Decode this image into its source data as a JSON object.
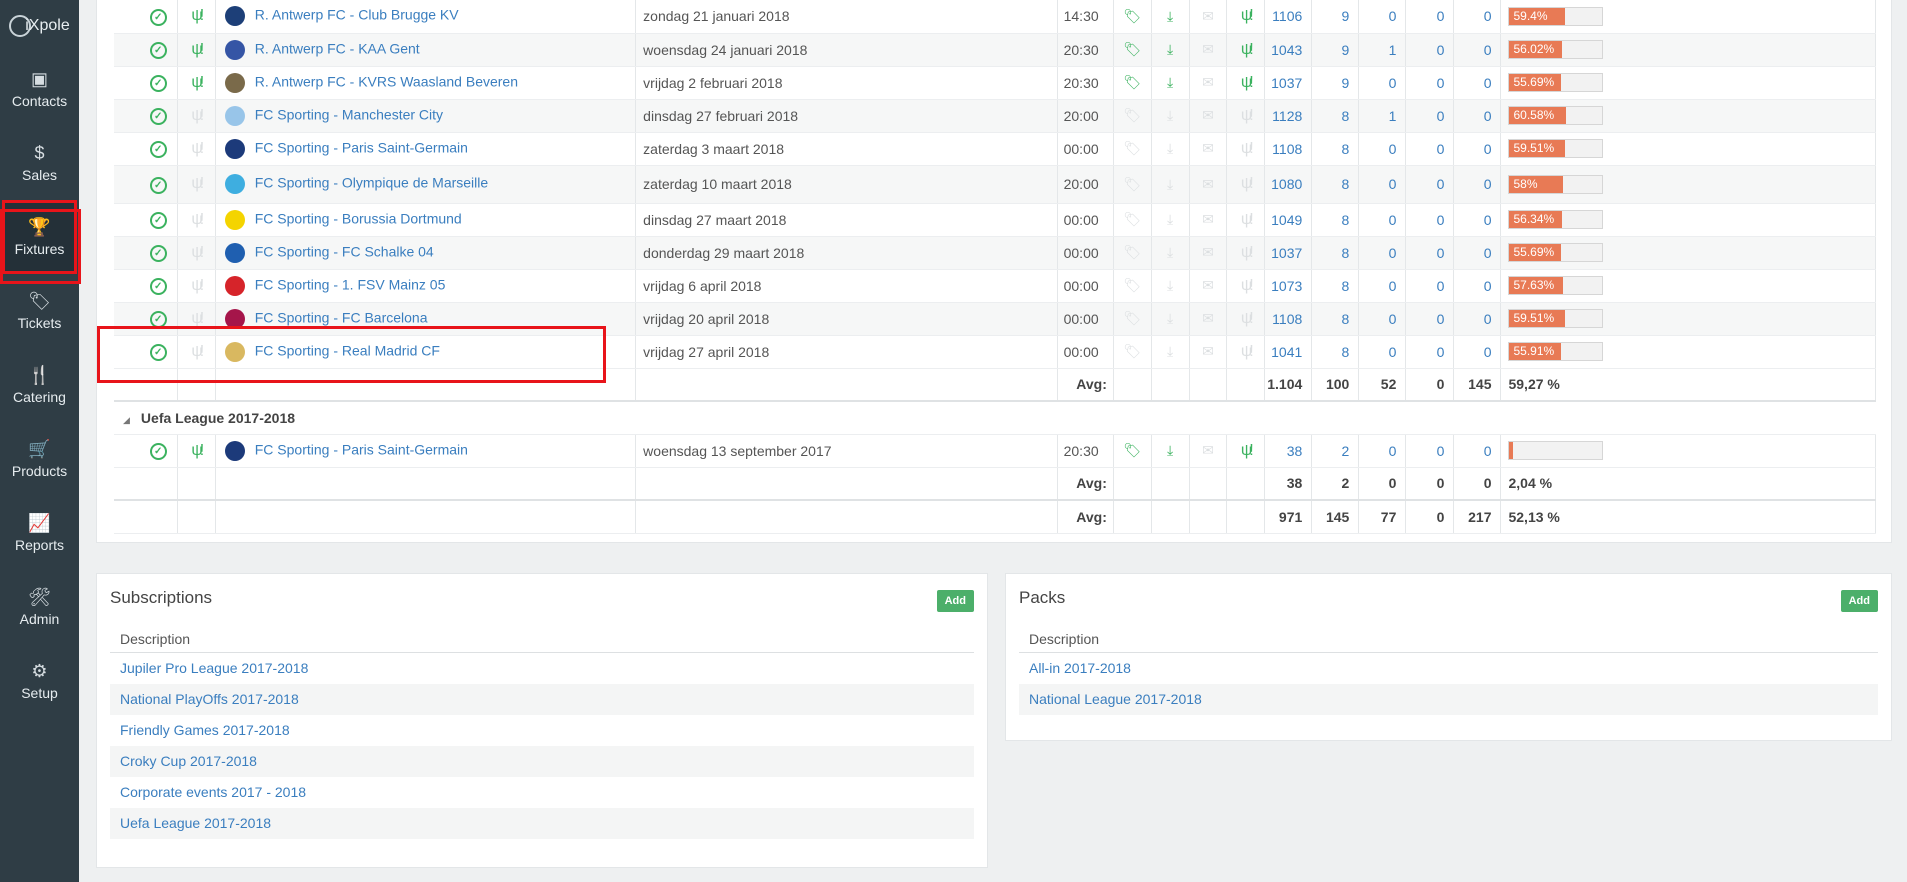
{
  "app": {
    "logo_text": "iXpole"
  },
  "sidebar": {
    "items": [
      {
        "label": "Contacts",
        "icon": "contacts-icon",
        "glyph": "▣"
      },
      {
        "label": "Sales",
        "icon": "coin-icon",
        "glyph": "$"
      },
      {
        "label": "Fixtures",
        "icon": "trophy-icon",
        "glyph": "🏆"
      },
      {
        "label": "Tickets",
        "icon": "ticket-icon",
        "glyph": "🏷"
      },
      {
        "label": "Catering",
        "icon": "fork-knife-icon",
        "glyph": "🍴"
      },
      {
        "label": "Products",
        "icon": "cart-icon",
        "glyph": "🛒"
      },
      {
        "label": "Reports",
        "icon": "chart-icon",
        "glyph": "📈"
      },
      {
        "label": "Admin",
        "icon": "tools-icon",
        "glyph": "🛠"
      },
      {
        "label": "Setup",
        "icon": "gears-icon",
        "glyph": "⚙"
      }
    ]
  },
  "fixtures": {
    "rows": [
      {
        "catering": true,
        "logo_color": "#1d3f78",
        "match": "R. Antwerp FC - Club Brugge KV",
        "date": "zondag 21 januari 2018",
        "time": "14:30",
        "icons_on": true,
        "n1": "1106",
        "n2": "9",
        "n3": "0",
        "n4": "0",
        "n5": "0",
        "pct": "59.4%",
        "pct_value": 59.4
      },
      {
        "catering": true,
        "logo_color": "#3555a5",
        "match": "R. Antwerp FC - KAA Gent",
        "date": "woensdag 24 januari 2018",
        "time": "20:30",
        "icons_on": true,
        "n1": "1043",
        "n2": "9",
        "n3": "1",
        "n4": "0",
        "n5": "0",
        "pct": "56.02%",
        "pct_value": 56.02
      },
      {
        "catering": true,
        "logo_color": "#7a6a4a",
        "match": "R. Antwerp FC - KVRS Waasland Beveren",
        "date": "vrijdag 2 februari 2018",
        "time": "20:30",
        "icons_on": true,
        "n1": "1037",
        "n2": "9",
        "n3": "0",
        "n4": "0",
        "n5": "0",
        "pct": "55.69%",
        "pct_value": 55.69
      },
      {
        "catering": false,
        "logo_color": "#98c5e9",
        "match": "FC Sporting - Manchester City",
        "date": "dinsdag 27 februari 2018",
        "time": "20:00",
        "icons_on": false,
        "n1": "1128",
        "n2": "8",
        "n3": "1",
        "n4": "0",
        "n5": "0",
        "pct": "60.58%",
        "pct_value": 60.58
      },
      {
        "catering": false,
        "logo_color": "#1c3a7a",
        "match": "FC Sporting - Paris Saint-Germain",
        "date": "zaterdag 3 maart 2018",
        "time": "00:00",
        "icons_on": false,
        "n1": "1108",
        "n2": "8",
        "n3": "0",
        "n4": "0",
        "n5": "0",
        "pct": "59.51%",
        "pct_value": 59.51
      },
      {
        "catering": false,
        "logo_color": "#3eaee0",
        "match": "FC Sporting - Olympique de Marseille",
        "date": "zaterdag 10 maart 2018",
        "time": "20:00",
        "icons_on": false,
        "n1": "1080",
        "n2": "8",
        "n3": "0",
        "n4": "0",
        "n5": "0",
        "pct": "58%",
        "pct_value": 58
      },
      {
        "catering": false,
        "logo_color": "#f4d400",
        "match": "FC Sporting - Borussia Dortmund",
        "date": "dinsdag 27 maart 2018",
        "time": "00:00",
        "icons_on": false,
        "n1": "1049",
        "n2": "8",
        "n3": "0",
        "n4": "0",
        "n5": "0",
        "pct": "56.34%",
        "pct_value": 56.34
      },
      {
        "catering": false,
        "logo_color": "#1f5fb0",
        "match": "FC Sporting - FC Schalke 04",
        "date": "donderdag 29 maart 2018",
        "time": "00:00",
        "icons_on": false,
        "n1": "1037",
        "n2": "8",
        "n3": "0",
        "n4": "0",
        "n5": "0",
        "pct": "55.69%",
        "pct_value": 55.69
      },
      {
        "catering": false,
        "logo_color": "#d6242a",
        "match": "FC Sporting - 1. FSV Mainz 05",
        "date": "vrijdag 6 april 2018",
        "time": "00:00",
        "icons_on": false,
        "n1": "1073",
        "n2": "8",
        "n3": "0",
        "n4": "0",
        "n5": "0",
        "pct": "57.63%",
        "pct_value": 57.63
      },
      {
        "catering": false,
        "logo_color": "#a5154a",
        "match": "FC Sporting - FC Barcelona",
        "date": "vrijdag 20 april 2018",
        "time": "00:00",
        "icons_on": false,
        "n1": "1108",
        "n2": "8",
        "n3": "0",
        "n4": "0",
        "n5": "0",
        "pct": "59.51%",
        "pct_value": 59.51
      },
      {
        "catering": false,
        "logo_color": "#d9b860",
        "match": "FC Sporting - Real Madrid CF",
        "date": "vrijdag 27 april 2018",
        "time": "00:00",
        "icons_on": false,
        "n1": "1041",
        "n2": "8",
        "n3": "0",
        "n4": "0",
        "n5": "0",
        "pct": "55.91%",
        "pct_value": 55.91
      }
    ],
    "group_avg": {
      "label": "Avg:",
      "n1": "1.104",
      "n2": "100",
      "n3": "52",
      "n4": "0",
      "n5": "145",
      "pct": "59,27 %"
    },
    "uefa_group": {
      "title": "Uefa League 2017-2018",
      "row": {
        "catering": true,
        "logo_color": "#1c3a7a",
        "match": "FC Sporting - Paris Saint-Germain",
        "date": "woensdag 13 september 2017",
        "time": "20:30",
        "icons_on": true,
        "n1": "38",
        "n2": "2",
        "n3": "0",
        "n4": "0",
        "n5": "0",
        "pct": "",
        "pct_value": 2.04
      },
      "avg": {
        "label": "Avg:",
        "n1": "38",
        "n2": "2",
        "n3": "0",
        "n4": "0",
        "n5": "0",
        "pct": "2,04 %"
      }
    },
    "total_avg": {
      "label": "Avg:",
      "n1": "971",
      "n2": "145",
      "n3": "77",
      "n4": "0",
      "n5": "217",
      "pct": "52,13 %"
    }
  },
  "subscriptions": {
    "title": "Subscriptions",
    "add_label": "Add",
    "column": "Description",
    "items": [
      "Jupiler Pro League 2017-2018",
      "National PlayOffs 2017-2018",
      "Friendly Games 2017-2018",
      "Croky Cup 2017-2018",
      "Corporate events 2017 - 2018",
      "Uefa League 2017-2018"
    ]
  },
  "packs": {
    "title": "Packs",
    "add_label": "Add",
    "column": "Description",
    "items": [
      "All-in 2017-2018",
      "National League 2017-2018"
    ]
  },
  "colors": {
    "accent_green": "#3bb25f",
    "link_blue": "#3a7ebf",
    "bar_orange": "#e87a55",
    "highlight_red": "#e8141a",
    "sidebar_bg": "#2f3d45"
  }
}
